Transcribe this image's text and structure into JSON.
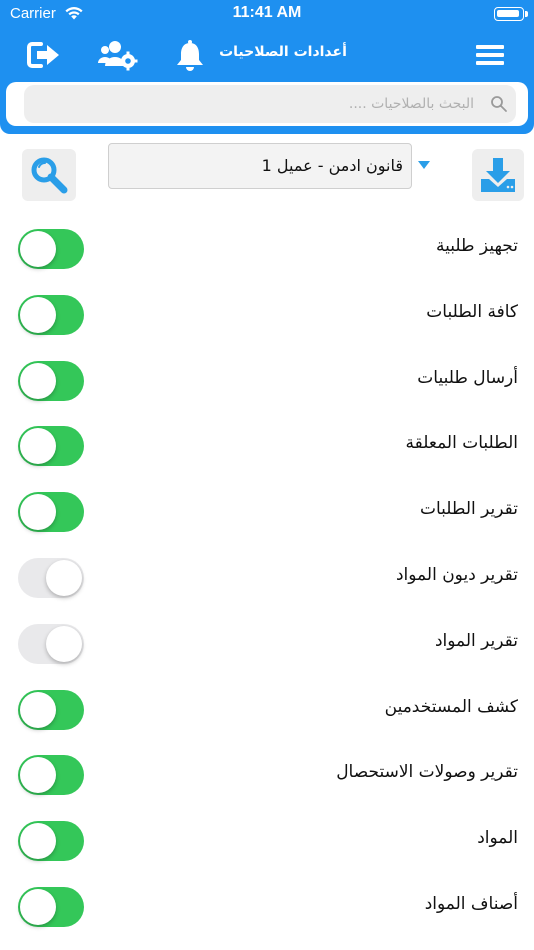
{
  "status_bar": {
    "carrier": "Carrier",
    "time": "11:41 AM"
  },
  "nav": {
    "title": "أعدادات الصلاحيات"
  },
  "search": {
    "placeholder": "البحث بالصلاحيات ...."
  },
  "selector": {
    "value": "قانون ادمن - عميل 1"
  },
  "colors": {
    "primary": "#1e90f0",
    "toggle_on": "#34c759",
    "toggle_off": "#e9e9eb"
  },
  "icons": {
    "nav": [
      "logout-icon",
      "user-settings-icon",
      "bell-icon",
      "menu-icon"
    ],
    "toolbar": [
      "download-icon",
      "search-icon"
    ]
  },
  "permissions": [
    {
      "label": "تجهيز طلبية",
      "enabled": true
    },
    {
      "label": "كافة الطلبات",
      "enabled": true
    },
    {
      "label": "أرسال طلبيات",
      "enabled": true
    },
    {
      "label": "الطلبات المعلقة",
      "enabled": true
    },
    {
      "label": "تقرير الطلبات",
      "enabled": true
    },
    {
      "label": "تقرير ديون المواد",
      "enabled": false
    },
    {
      "label": "تقرير المواد",
      "enabled": false
    },
    {
      "label": "كشف المستخدمين",
      "enabled": true
    },
    {
      "label": "تقرير وصولات الاستحصال",
      "enabled": true
    },
    {
      "label": "المواد",
      "enabled": true
    },
    {
      "label": "أصناف المواد",
      "enabled": true
    }
  ]
}
